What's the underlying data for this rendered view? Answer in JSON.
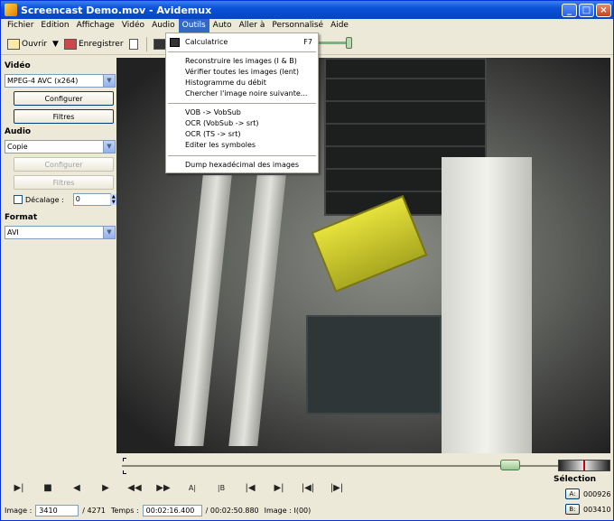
{
  "window": {
    "title": "Screencast Demo.mov - Avidemux"
  },
  "menubar": [
    "Fichier",
    "Edition",
    "Affichage",
    "Vidéo",
    "Audio",
    "Outils",
    "Auto",
    "Aller à",
    "Personnalisé",
    "Aide"
  ],
  "toolbar": {
    "open_label": "Ouvrir",
    "save_label": "Enregistrer",
    "calc_label": "C"
  },
  "outils_menu": {
    "items": [
      {
        "label": "Calculatrice",
        "accel": "F7"
      },
      {
        "label": "Reconstruire les images (I & B)"
      },
      {
        "label": "Vérifier toutes les images (lent)"
      },
      {
        "label": "Histogramme du débit"
      },
      {
        "label": "Chercher l'image noire suivante..."
      },
      {
        "label": "VOB -> VobSub"
      },
      {
        "label": "OCR (VobSub -> srt)"
      },
      {
        "label": "OCR (TS -> srt)"
      },
      {
        "label": "Editer les symboles"
      },
      {
        "label": "Dump hexadécimal des images"
      }
    ]
  },
  "video_section": {
    "title": "Vidéo",
    "codec": "MPEG-4 AVC (x264)",
    "configure": "Configurer",
    "filters": "Filtres"
  },
  "audio_section": {
    "title": "Audio",
    "codec": "Copie",
    "configure": "Configurer",
    "filters": "Filtres",
    "shift_label": "Décalage :",
    "shift_value": "0"
  },
  "format_section": {
    "title": "Format",
    "container": "AVI"
  },
  "selection": {
    "title": "Sélection",
    "a_label": "A:",
    "a_value": "000926",
    "b_label": "B:",
    "b_value": "003410"
  },
  "status": {
    "image_label": "Image :",
    "image_value": "3410",
    "total": "/ 4271",
    "time_label": "Temps :",
    "time_value": "00:02:16.400",
    "duration": "/ 00:02:50.880",
    "frame_type": "Image : I(00)"
  },
  "timeline": {
    "position_fraction": 0.8
  },
  "colors": {
    "titlebar": "#0a52d8",
    "menu_highlight": "#316ac5",
    "window_bg": "#ece9d8"
  }
}
